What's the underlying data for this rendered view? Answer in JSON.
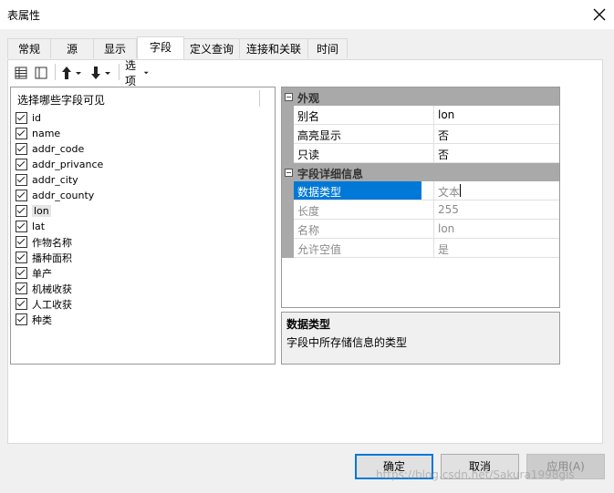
{
  "window": {
    "title": "表属性",
    "close_icon": "close-icon"
  },
  "tabs": [
    {
      "label": "常规"
    },
    {
      "label": "源"
    },
    {
      "label": "显示"
    },
    {
      "label": "字段",
      "active": true
    },
    {
      "label": "定义查询"
    },
    {
      "label": "连接和关联"
    },
    {
      "label": "时间"
    }
  ],
  "toolbar": {
    "icons": [
      "table-view-icon",
      "list-view-icon",
      "move-up-icon",
      "move-down-icon"
    ],
    "options_label": "选项"
  },
  "fields": {
    "header": "选择哪些字段可见",
    "items": [
      {
        "name": "id",
        "checked": true
      },
      {
        "name": "name",
        "checked": true
      },
      {
        "name": "addr_code",
        "checked": true
      },
      {
        "name": "addr_privance",
        "checked": true
      },
      {
        "name": "addr_city",
        "checked": true
      },
      {
        "name": "addr_county",
        "checked": true
      },
      {
        "name": "lon",
        "checked": true,
        "selected": true
      },
      {
        "name": "lat",
        "checked": true
      },
      {
        "name": "作物名称",
        "checked": true
      },
      {
        "name": "播种面积",
        "checked": true
      },
      {
        "name": "单产",
        "checked": true
      },
      {
        "name": "机械收获",
        "checked": true
      },
      {
        "name": "人工收获",
        "checked": true
      },
      {
        "name": "种类",
        "checked": true
      }
    ]
  },
  "properties": {
    "appearance": {
      "title": "外观",
      "rows": [
        {
          "name": "别名",
          "value": "lon"
        },
        {
          "name": "高亮显示",
          "value": "否"
        },
        {
          "name": "只读",
          "value": "否"
        }
      ]
    },
    "details": {
      "title": "字段详细信息",
      "rows": [
        {
          "name": "数据类型",
          "value": "文本",
          "selected": true
        },
        {
          "name": "长度",
          "value": "255"
        },
        {
          "name": "名称",
          "value": "lon"
        },
        {
          "name": "允许空值",
          "value": "是"
        }
      ]
    }
  },
  "description": {
    "title": "数据类型",
    "text": "字段中所存储信息的类型"
  },
  "buttons": {
    "ok": "确定",
    "cancel": "取消",
    "apply": "应用(A)"
  },
  "watermark": "https://blog.csdn.net/Sakura1998gis",
  "colors": {
    "selection": "#0078d7",
    "category": "#a9a9a9"
  }
}
